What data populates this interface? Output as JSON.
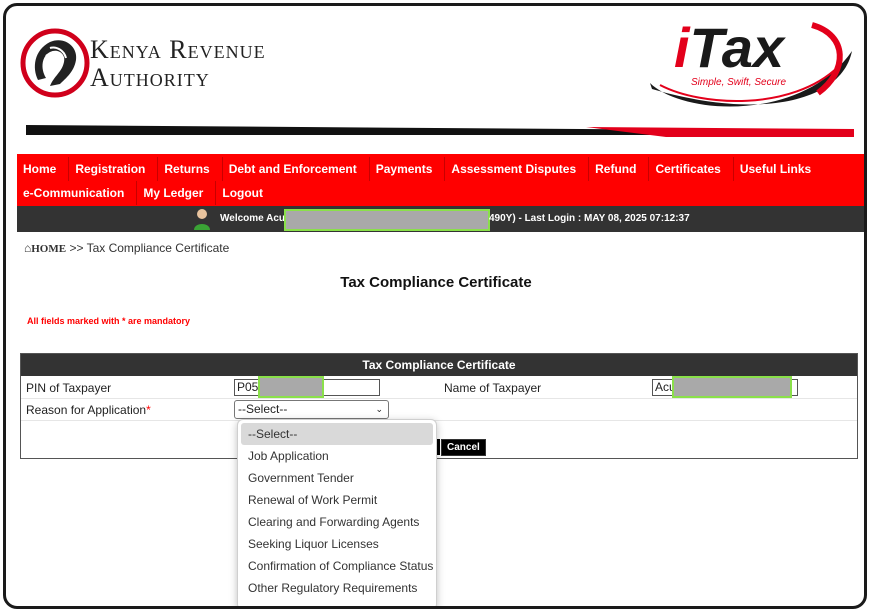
{
  "header": {
    "org_name_line1": "Kenya Revenue",
    "org_name_line2": "Authority",
    "itax_brand_i": "i",
    "itax_brand_tax": "Tax",
    "itax_tagline": "Simple, Swift, Secure"
  },
  "nav": {
    "row1": [
      "Home",
      "Registration",
      "Returns",
      "Debt and Enforcement",
      "Payments",
      "Assessment Disputes",
      "Refund",
      "Certificates",
      "Useful Links"
    ],
    "row2": [
      "e-Communication",
      "My Ledger",
      "Logout"
    ]
  },
  "welcome": {
    "prefix": "Welcome Acu",
    "suffix": "490Y)  - Last Login : MAY 08, 2025 07:12:37"
  },
  "breadcrumb": {
    "home": "HOME",
    "separator": ">>",
    "current": "Tax Compliance Certificate"
  },
  "page": {
    "title": "Tax Compliance Certificate",
    "mandatory_note": "All fields marked with * are mandatory"
  },
  "form": {
    "heading": "Tax Compliance Certificate",
    "pin_label": "PIN of Taxpayer",
    "pin_value": "P05",
    "name_label": "Name of Taxpayer",
    "name_value": "Acu",
    "reason_label": "Reason for Application",
    "reason_required_mark": "*",
    "reason_selected": "--Select--",
    "cancel_label": "Cancel"
  },
  "dropdown": {
    "options": [
      "--Select--",
      "Job Application",
      "Government Tender",
      "Renewal of Work Permit",
      "Clearing and Forwarding Agents",
      "Seeking Liquor Licenses",
      "Confirmation of Compliance Status",
      "Other Regulatory Requirements"
    ],
    "selected_index": 0
  },
  "colors": {
    "nav_red": "#ff0000",
    "dark_bar": "#333333",
    "redaction_outline": "#8ae04a",
    "brand_red": "#e3001b"
  }
}
